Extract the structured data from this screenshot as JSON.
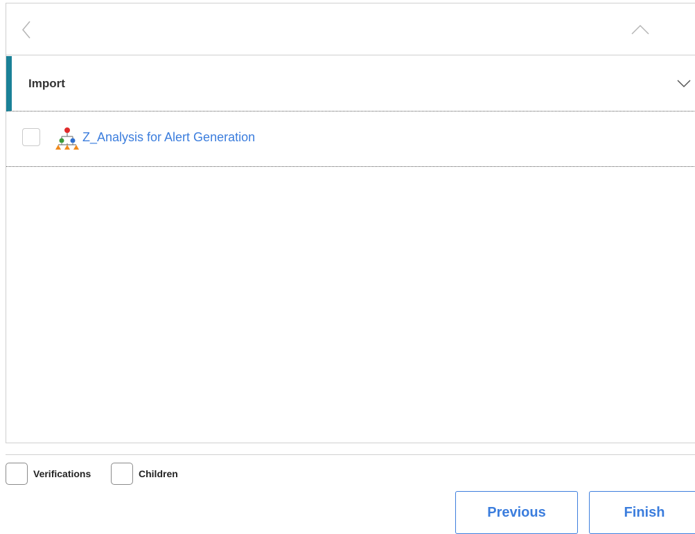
{
  "nav": {
    "back_icon": "chevron-left-icon",
    "collapse_icon": "chevron-up-icon"
  },
  "section": {
    "title": "Import",
    "expand_icon": "chevron-down-icon",
    "accent_color": "#1a8197"
  },
  "items": [
    {
      "label": "Z_Analysis for Alert Generation",
      "icon": "hierarchy-tree-icon",
      "checked": false
    }
  ],
  "options": {
    "verifications_label": "Verifications",
    "children_label": "Children"
  },
  "buttons": {
    "previous_label": "Previous",
    "finish_label": "Finish"
  },
  "colors": {
    "link": "#3b7ddd",
    "border": "#cfcfcf"
  }
}
